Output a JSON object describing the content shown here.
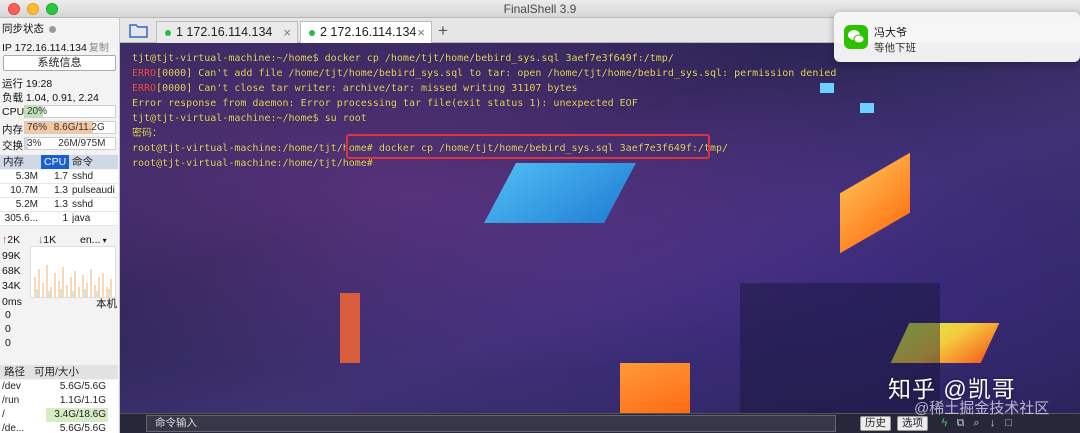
{
  "window": {
    "title": "FinalShell 3.9"
  },
  "sidebar": {
    "sync_label": "同步状态",
    "ip_label": "IP 172.16.114.134",
    "copy_label": "复制",
    "sysinfo_button": "系统信息",
    "uptime": "运行 19:28",
    "load": "负载 1.04, 0.91, 2.24",
    "cpu": {
      "label": "CPU",
      "value": "20%",
      "fraction": 0.2
    },
    "memory": {
      "label": "内存",
      "percent": "76%",
      "value": "8.6G/11.2G",
      "fraction": 0.76
    },
    "swap": {
      "label": "交换",
      "percent": "3%",
      "value": "26M/975M",
      "fraction": 0.03
    },
    "process_headers": {
      "mem": "内存",
      "cpu": "CPU",
      "cmd": "命令"
    },
    "processes": [
      {
        "mem": "5.3M",
        "cpu": "1.7",
        "cmd": "sshd"
      },
      {
        "mem": "10.7M",
        "cpu": "1.3",
        "cmd": "pulseaudi"
      },
      {
        "mem": "5.2M",
        "cpu": "1.3",
        "cmd": "sshd"
      },
      {
        "mem": "305.6...",
        "cpu": "1",
        "cmd": "java"
      }
    ],
    "network": {
      "up": "2K",
      "down": "1K",
      "iface": "en...",
      "scale": [
        "99K",
        "68K",
        "34K"
      ]
    },
    "latency": {
      "label": "0ms",
      "target": "本机",
      "values": [
        "0",
        "0",
        "0"
      ]
    },
    "disk_headers": {
      "path": "路径",
      "avail": "可用/大小"
    },
    "disks": [
      {
        "path": "/dev",
        "value": "5.6G/5.6G"
      },
      {
        "path": "/run",
        "value": "1.1G/1.1G"
      },
      {
        "path": "/",
        "value": "3.4G/18.6G"
      },
      {
        "path": "/de...",
        "value": "5.6G/5.6G"
      }
    ]
  },
  "tabs": [
    {
      "label": "1 172.16.114.134",
      "active": false
    },
    {
      "label": "2 172.16.114.134",
      "active": true
    }
  ],
  "add_tab": "+",
  "terminal": {
    "lines": [
      {
        "err": "",
        "text": "tjt@tjt-virtual-machine:~/home$ docker cp /home/tjt/home/bebird_sys.sql 3aef7e3f649f:/tmp/"
      },
      {
        "err": "ERRO",
        "text": "[0000] Can't add file /home/tjt/home/bebird_sys.sql to tar: open /home/tjt/home/bebird_sys.sql: permission denied"
      },
      {
        "err": "ERRO",
        "text": "[0000] Can't close tar writer: archive/tar: missed writing 31107 bytes"
      },
      {
        "err": "",
        "text": "Error response from daemon: Error processing tar file(exit status 1): unexpected EOF"
      },
      {
        "err": "",
        "text": "tjt@tjt-virtual-machine:~/home$ su root"
      },
      {
        "err": "",
        "text": "密码："
      },
      {
        "err": "",
        "text": "root@tjt-virtual-machine:/home/tjt/home# docker cp /home/tjt/home/bebird_sys.sql 3aef7e3f649f:/tmp/"
      },
      {
        "err": "",
        "text": "root@tjt-virtual-machine:/home/tjt/home#"
      }
    ]
  },
  "command_bar": {
    "placeholder": "命令输入",
    "history_button": "历史",
    "options_button": "选项"
  },
  "notification": {
    "app_icon": "wechat-icon",
    "title": "冯大爷",
    "message": "等他下班"
  },
  "watermark": {
    "main": "知乎 @凯哥",
    "sub": "@稀土掘金技术社区"
  },
  "colors": {
    "accent": "#1a5fd0",
    "prompt": "#e8d66a",
    "error": "#ff5050",
    "highlight_box": "#e0343c"
  }
}
